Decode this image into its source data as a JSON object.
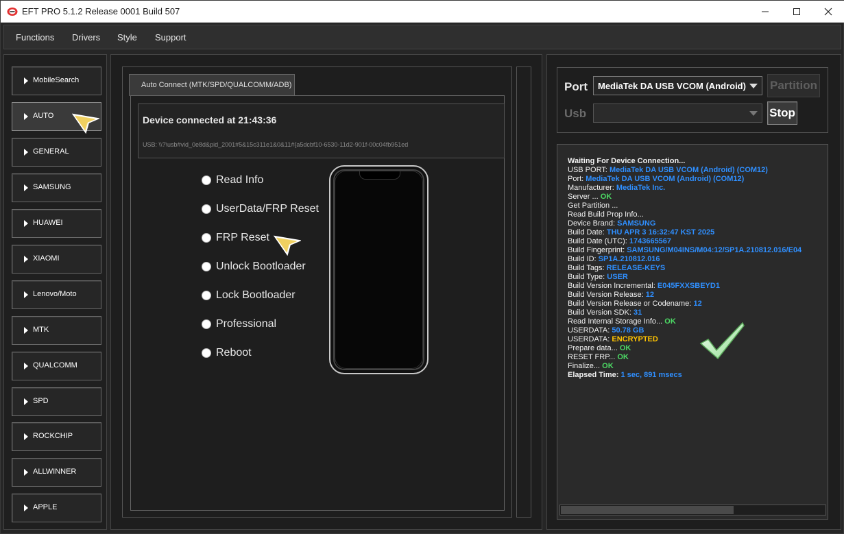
{
  "window": {
    "title": "EFT PRO 5.1.2 Release 0001 Build 507",
    "controls": [
      "minimize",
      "maximize",
      "close"
    ]
  },
  "menu": {
    "items": [
      "Functions",
      "Drivers",
      "Style",
      "Support"
    ]
  },
  "sidebar": {
    "items": [
      "MobileSearch",
      "AUTO",
      "GENERAL",
      "SAMSUNG",
      "HUAWEI",
      "XIAOMI",
      "Lenovo/Moto",
      "MTK",
      "QUALCOMM",
      "SPD",
      "ROCKCHIP",
      "ALLWINNER",
      "APPLE"
    ],
    "active": "AUTO"
  },
  "center": {
    "tab_label": "Auto Connect (MTK/SPD/QUALCOMM/ADB)",
    "device_status": "Device connected at 21:43:36",
    "usb_path": "USB: \\\\?\\usb#vid_0e8d&pid_2001#5&15c311e1&0&11#{a5dcbf10-6530-11d2-901f-00c04fb951ed",
    "options": [
      "Read Info",
      "UserData/FRP Reset",
      "FRP Reset",
      "Unlock Bootloader",
      "Lock Bootloader",
      "Professional",
      "Reboot"
    ]
  },
  "right": {
    "port_label": "Port",
    "port_value": "MediaTek DA USB VCOM (Android)",
    "partition_label": "Partition",
    "usb_label": "Usb",
    "usb_value": "",
    "stop_label": "Stop"
  },
  "log": {
    "lines": [
      {
        "k": "Waiting For Device Connection...",
        "v": "",
        "c": "",
        "bold": true
      },
      {
        "k": "USB PORT: ",
        "v": "MediaTek DA USB VCOM (Android) (COM12)",
        "c": "blue"
      },
      {
        "k": "Port: ",
        "v": "MediaTek DA USB VCOM (Android) (COM12)",
        "c": "blue"
      },
      {
        "k": "Manufacturer: ",
        "v": "MediaTek Inc.",
        "c": "blue"
      },
      {
        "k": "Server ... ",
        "v": "OK",
        "c": "green"
      },
      {
        "k": "Get Partition ...",
        "v": "",
        "c": ""
      },
      {
        "k": "Read Build Prop Info...",
        "v": "",
        "c": ""
      },
      {
        "k": " Device Brand: ",
        "v": "SAMSUNG",
        "c": "blue"
      },
      {
        "k": " Build Date: ",
        "v": "THU APR  3 16:32:47 KST 2025",
        "c": "blue"
      },
      {
        "k": " Build Date (UTC): ",
        "v": "1743665567",
        "c": "blue"
      },
      {
        "k": " Build Fingerprint: ",
        "v": "SAMSUNG/M04INS/M04:12/SP1A.210812.016/E04",
        "c": "blue"
      },
      {
        "k": " Build ID: ",
        "v": "SP1A.210812.016",
        "c": "blue"
      },
      {
        "k": " Build Tags: ",
        "v": "RELEASE-KEYS",
        "c": "blue"
      },
      {
        "k": " Build Type: ",
        "v": "USER",
        "c": "blue"
      },
      {
        "k": " Build Version Incremental: ",
        "v": "E045FXXSBEYD1",
        "c": "blue"
      },
      {
        "k": " Build Version Release: ",
        "v": "12",
        "c": "blue"
      },
      {
        "k": " Build Version Release or Codename: ",
        "v": "12",
        "c": "blue"
      },
      {
        "k": " Build Version SDK: ",
        "v": "31",
        "c": "blue"
      },
      {
        "k": "Read Internal Storage Info... ",
        "v": "OK",
        "c": "green"
      },
      {
        "k": "USERDATA: ",
        "v": "50.78 GB",
        "c": "blue"
      },
      {
        "k": "USERDATA: ",
        "v": "ENCRYPTED",
        "c": "yellow"
      },
      {
        "k": "Prepare data... ",
        "v": "OK",
        "c": "green"
      },
      {
        "k": "RESET FRP... ",
        "v": "OK",
        "c": "green"
      },
      {
        "k": "Finalize... ",
        "v": "OK",
        "c": "green"
      },
      {
        "k": "Elapsed Time: ",
        "v": "1 sec, 891 msecs",
        "c": "blue",
        "bold": true
      }
    ],
    "scroll_fraction": 0.65
  },
  "icons": {
    "app": "eft-logo-icon",
    "success": "checkmark-icon",
    "pointer": "arrow-cursor-icon"
  }
}
